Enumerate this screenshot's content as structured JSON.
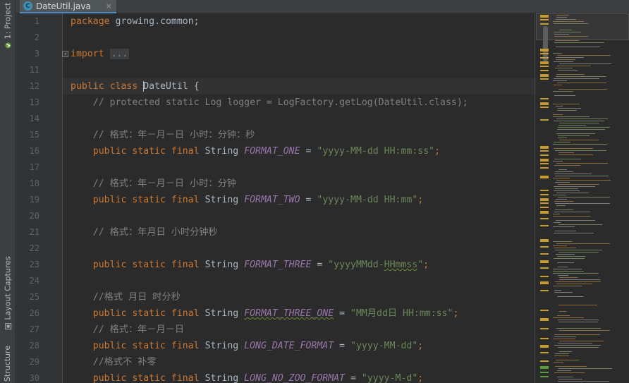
{
  "tool_windows": {
    "project": "1: Project",
    "layout_captures": "Layout Captures",
    "structure": "Structure"
  },
  "editor_tab": {
    "badge": "C",
    "title": "DateUtil.java",
    "close": "×"
  },
  "gutter": {
    "line_numbers": [
      "1",
      "2",
      "3",
      "11",
      "12",
      "13",
      "14",
      "15",
      "16",
      "17",
      "18",
      "19",
      "20",
      "21",
      "22",
      "23",
      "24",
      "25",
      "26",
      "27",
      "28",
      "29",
      "30"
    ]
  },
  "code": {
    "l1_kw": "package",
    "l1_rest": " growing.common;",
    "l3_kw": "import",
    "l3_fold": "...",
    "l12_kw": "public class ",
    "l12_name": "DateUtil",
    "l12_brace": " {",
    "l13": "    // protected static Log logger = LogFactory.getLog(DateUtil.class);",
    "l15": "    // 格式：年－月－日 小时：分钟：秒",
    "l16_kw": "    public static final ",
    "l16_type": "String ",
    "l16_const": "FORMAT_ONE",
    "l16_eq": " = ",
    "l16_str": "\"yyyy-MM-dd HH:mm:ss\"",
    "l16_end": ";",
    "l18": "    // 格式：年－月－日 小时：分钟",
    "l19_const": "FORMAT_TWO",
    "l19_str": "\"yyyy-MM-dd HH:mm\"",
    "l21": "    // 格式：年月日 小时分钟秒",
    "l23_const": "FORMAT_THREE",
    "l23_str_a": "\"yyyyMMdd-",
    "l23_str_b": "HHmmss",
    "l23_str_c": "\"",
    "l25": "    //格式 月日 时分秒",
    "l26_const": "FORMAT_THREE_ONE",
    "l26_str": "\"MM月dd日 HH:mm:ss\"",
    "l27": "    // 格式：年－月－日",
    "l28_const": "LONG_DATE_FORMAT",
    "l28_str": "\"yyyy-MM-dd\"",
    "l29": "    //格式不 补零",
    "l30_const": "LONG_NO_ZOO_FORMAT",
    "l30_str": "\"yyyy-M-d\""
  },
  "colors": {
    "keyword": "#cc7832",
    "comment": "#808080",
    "string": "#6a8759",
    "constant": "#9876aa",
    "text": "#a9b7c6",
    "warning_stripe": "#c79c2e"
  }
}
